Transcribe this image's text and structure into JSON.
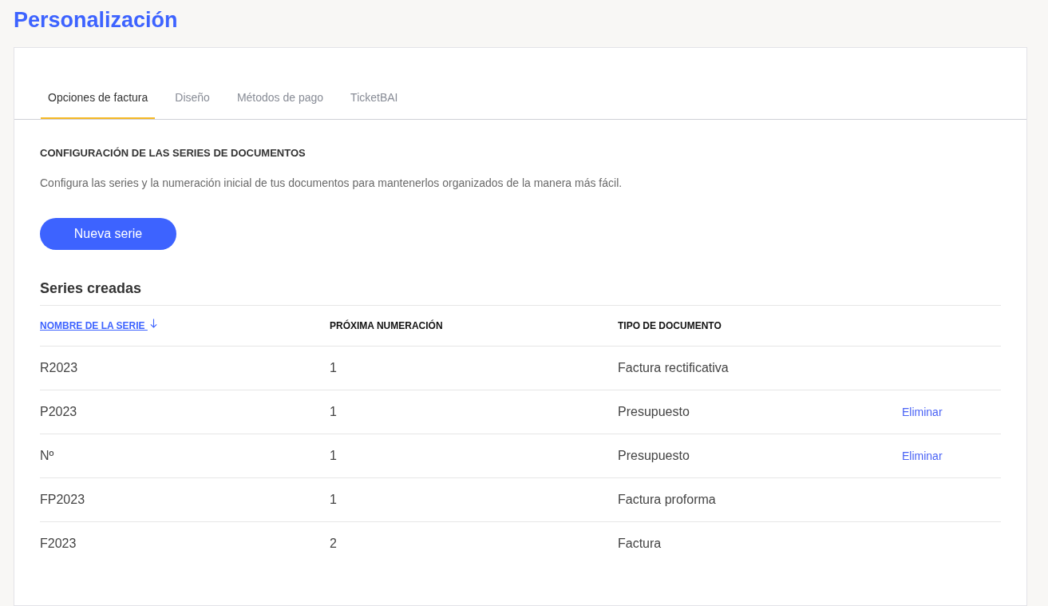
{
  "page_title": "Personalización",
  "tabs": [
    {
      "label": "Opciones de factura",
      "selected": true
    },
    {
      "label": "Diseño",
      "selected": false
    },
    {
      "label": "Métodos de pago",
      "selected": false
    },
    {
      "label": "TicketBAI",
      "selected": false
    }
  ],
  "section": {
    "heading": "CONFIGURACIÓN DE LAS SERIES DE DOCUMENTOS",
    "description": "Configura las series y la numeración inicial de tus documentos para mantenerlos organizados de la manera más fácil.",
    "button": "Nueva serie"
  },
  "table": {
    "title": "Series creadas",
    "columns": [
      {
        "label": "NOMBRE DE LA SERIE",
        "sorted": true
      },
      {
        "label": "PRÓXIMA NUMERACIÓN",
        "sorted": false
      },
      {
        "label": "TIPO DE DOCUMENTO",
        "sorted": false
      }
    ],
    "rows": [
      {
        "name": "R2023",
        "next_number": "1",
        "document_type": "Factura rectificativa"
      },
      {
        "name": "P2023",
        "next_number": "1",
        "document_type": "Presupuesto",
        "action": "Eliminar"
      },
      {
        "name": "Nº",
        "next_number": "1",
        "document_type": "Presupuesto",
        "action": "Eliminar"
      },
      {
        "name": "FP2023",
        "next_number": "1",
        "document_type": "Factura proforma"
      },
      {
        "name": "F2023",
        "next_number": "2",
        "document_type": "Factura"
      }
    ]
  }
}
